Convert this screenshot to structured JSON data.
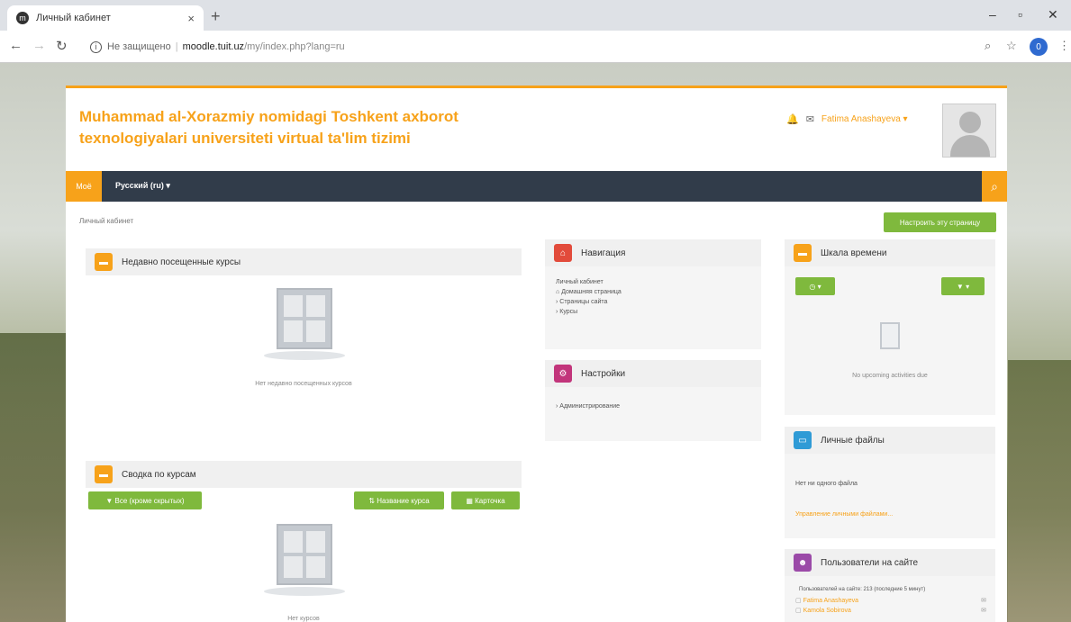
{
  "browser": {
    "tab_title": "Личный кабинет",
    "tab_close": "×",
    "new_tab": "+",
    "address_security": "Не защищено",
    "address_domain": "moodle.tuit.uz",
    "address_path": "/my/index.php?lang=ru",
    "profile_initial": "0"
  },
  "site": {
    "title": "Muhammad al-Xorazmiy nomidagi Toshkent axborot texnologiyalari universiteti virtual ta'lim tizimi",
    "user_name": "Fatima Anashayeva"
  },
  "navbar": {
    "home": "Моё",
    "language": "Русский (ru) ▾"
  },
  "breadcrumb": "Личный кабинет",
  "customise_button": "Настроить эту страницу",
  "blocks": {
    "recent_courses": {
      "title": "Недавно посещенные курсы",
      "empty": "Нет недавно посещенных курсов"
    },
    "course_overview": {
      "title": "Сводка по курсам",
      "filter_button": "Все (кроме скрытых)",
      "sort_button": "Название курса",
      "view_button": "Карточка",
      "empty": "Нет курсов"
    },
    "navigation": {
      "title": "Навигация",
      "items": [
        "Личный кабинет",
        "Домашняя страница",
        "Страницы сайта",
        "Курсы"
      ]
    },
    "settings": {
      "title": "Настройки",
      "items": [
        "Администрирование"
      ]
    },
    "timeline": {
      "title": "Шкала времени",
      "empty": "No upcoming activities due"
    },
    "private_files": {
      "title": "Личные файлы",
      "empty": "Нет ни одного файла",
      "manage_link": "Управление личными файлами..."
    },
    "online_users": {
      "title": "Пользователи на сайте",
      "summary": "Пользователей на сайте: 213 (последние 5 минут)",
      "users": [
        "Fatima Anashayeva",
        "Kamola Sobirova"
      ]
    }
  },
  "colors": {
    "accent": "#f7a21a",
    "navbar": "#313c4a",
    "green": "#7fb93d",
    "navigation_icon": "#e24b3b",
    "settings_icon": "#c2357b",
    "files_icon": "#2f9bd6",
    "users_icon": "#9b4aa8"
  }
}
